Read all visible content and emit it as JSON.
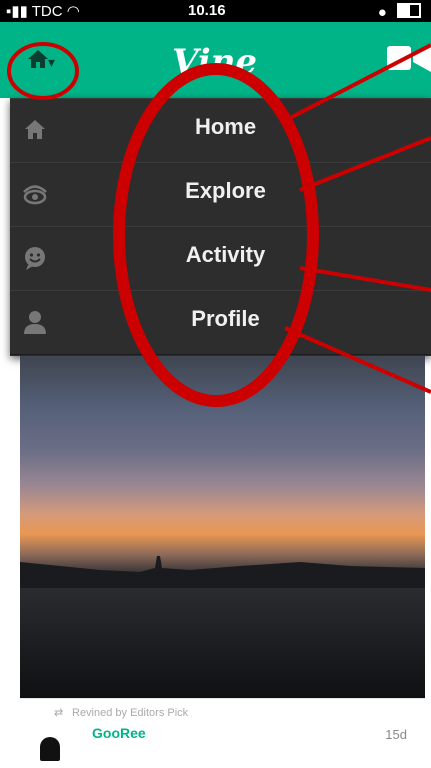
{
  "status_bar": {
    "carrier": "TDC",
    "time": "10.16"
  },
  "nav": {
    "logo": "Vine",
    "home_icon": "home-icon",
    "camera_icon": "video-camera-icon"
  },
  "menu": {
    "items": [
      {
        "label": "Home",
        "icon": "home-icon"
      },
      {
        "label": "Explore",
        "icon": "eye-icon"
      },
      {
        "label": "Activity",
        "icon": "smiley-icon"
      },
      {
        "label": "Profile",
        "icon": "person-icon"
      }
    ]
  },
  "post": {
    "revine_text": "Revined by Editors Pick",
    "username": "GooRee",
    "age": "15d"
  },
  "colors": {
    "brand_green": "#00b488",
    "menu_bg": "#2d2d2d",
    "annotation_red": "#cc0000"
  }
}
